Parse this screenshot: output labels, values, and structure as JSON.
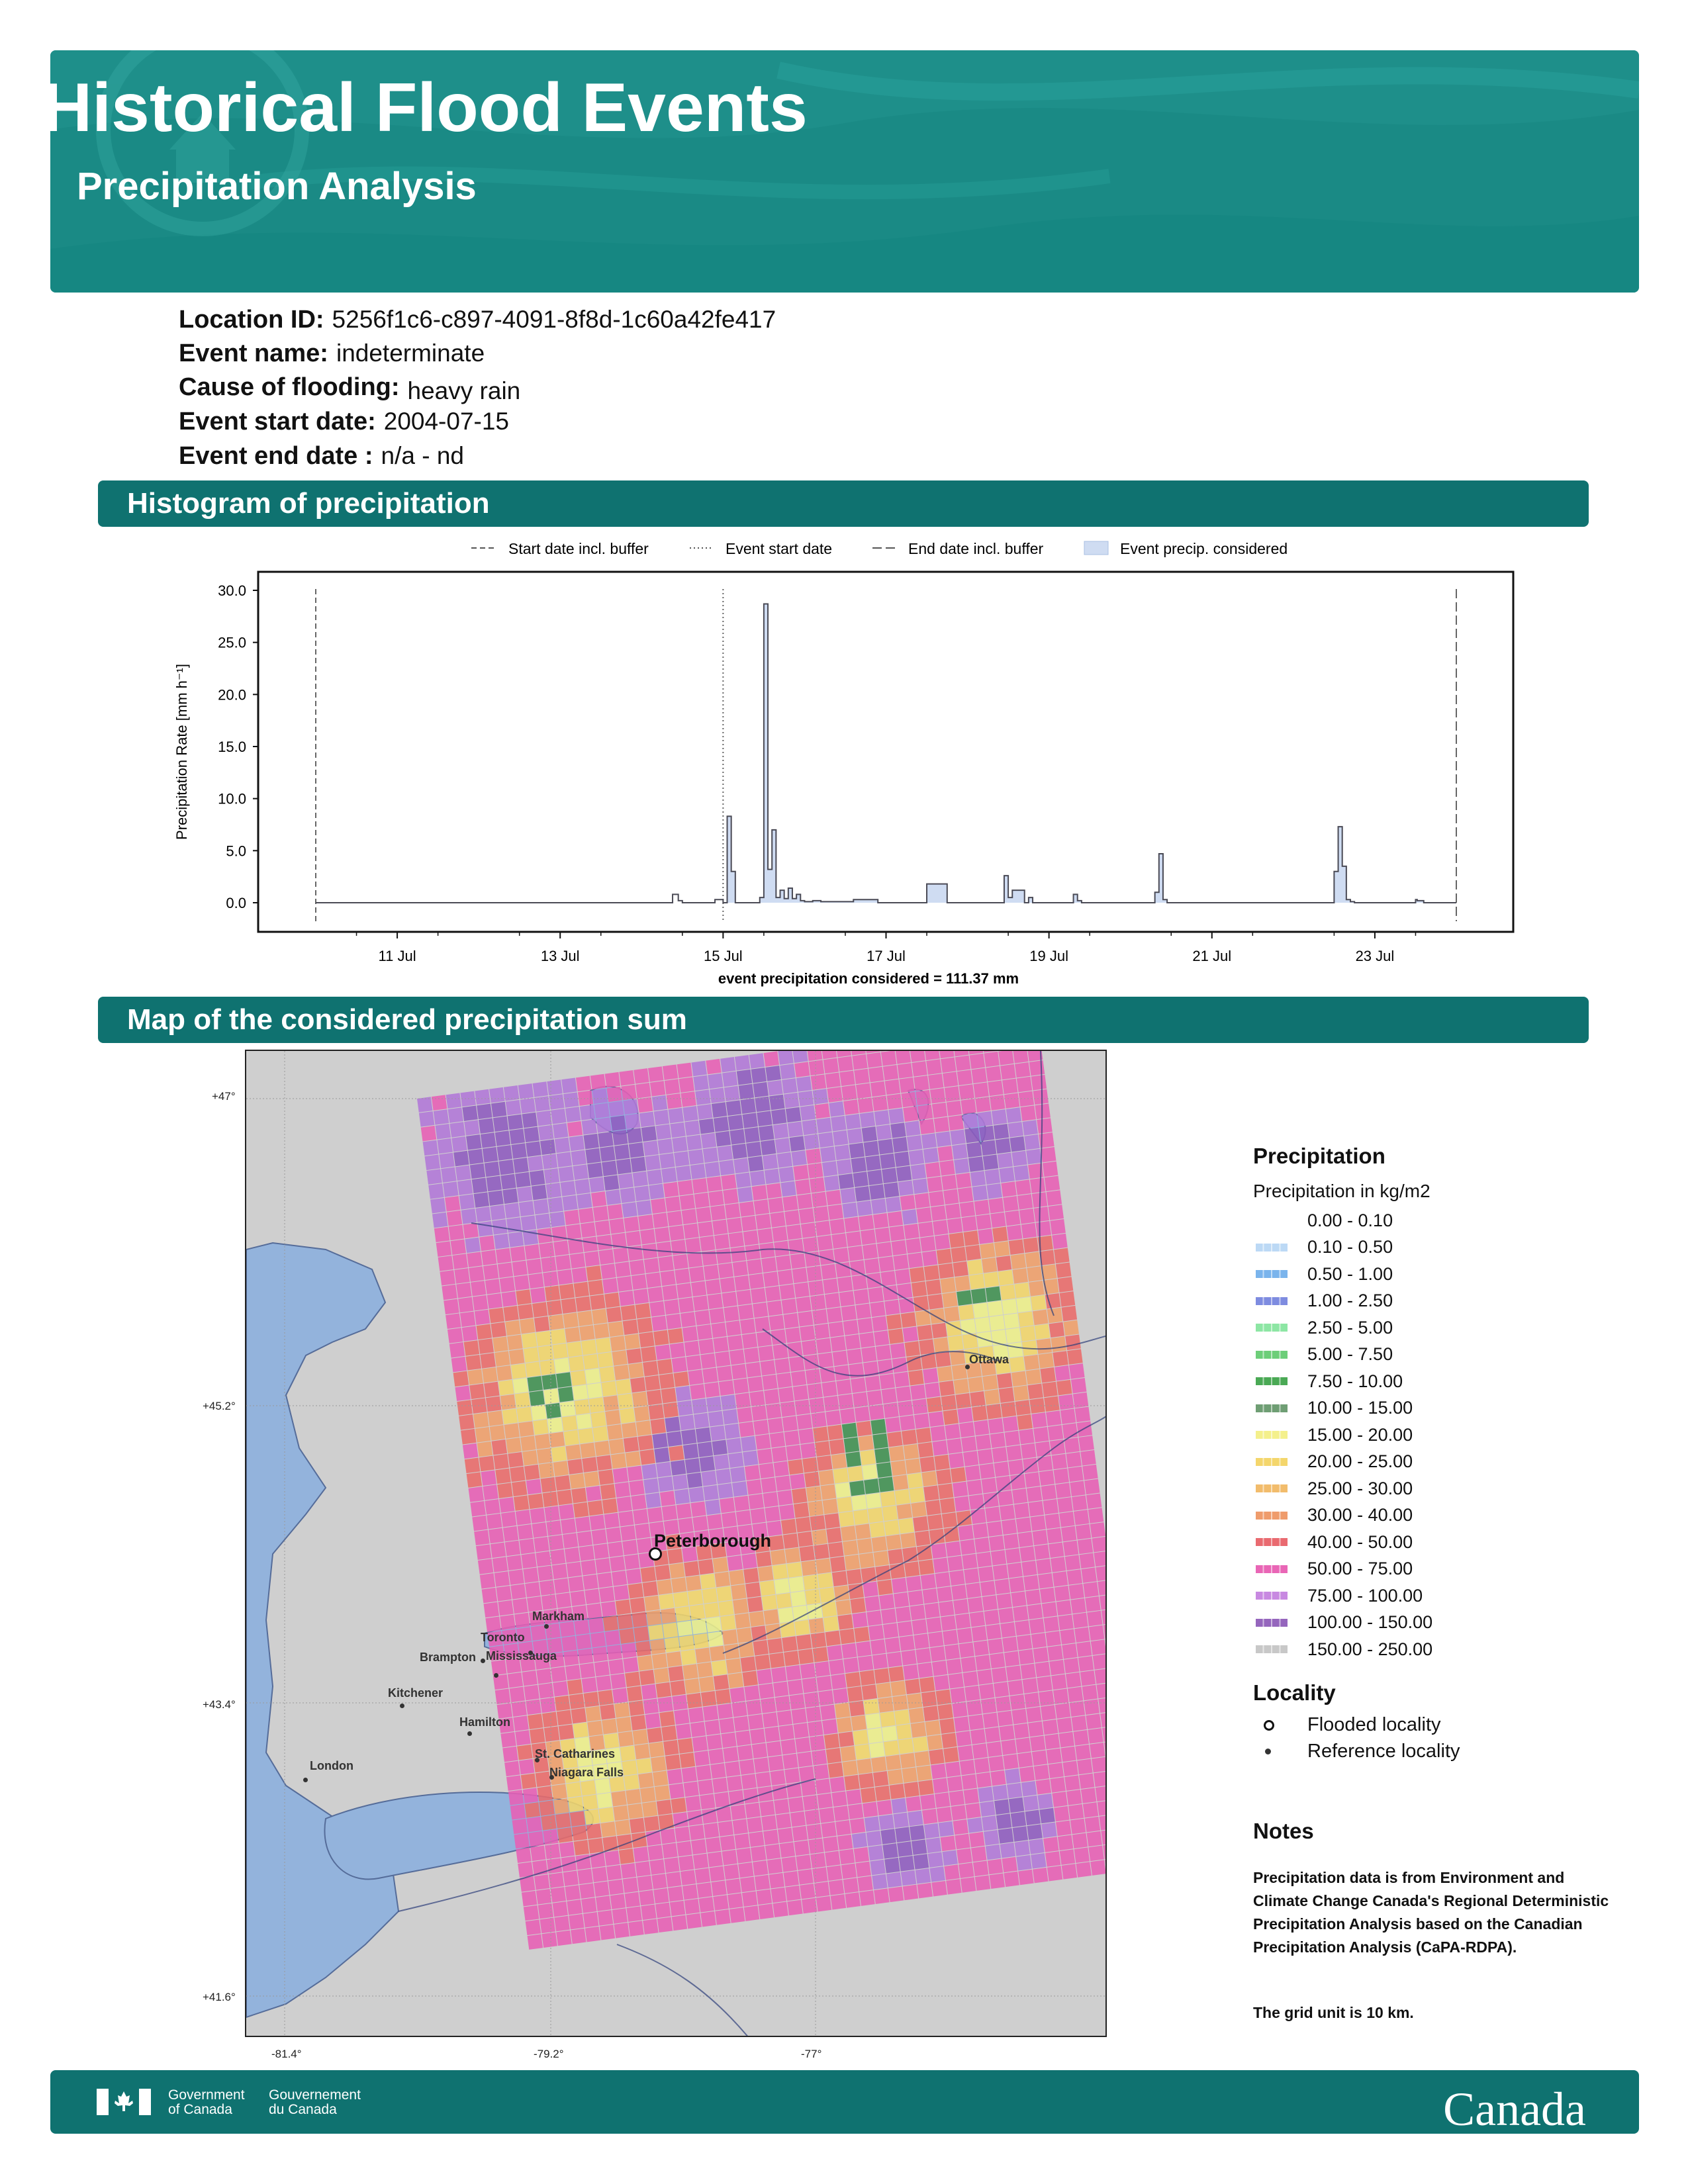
{
  "header": {
    "title": "Historical Flood Events",
    "subtitle": "Precipitation Analysis"
  },
  "event_info": {
    "location_id": {
      "label": "Location ID:",
      "value": "5256f1c6-c897-4091-8f8d-1c60a42fe417"
    },
    "event_name": {
      "label": "Event name:",
      "value": "indeterminate"
    },
    "cause": {
      "label": "Cause of flooding:",
      "value": "heavy rain"
    },
    "start_date": {
      "label": "Event start date:",
      "value": "2004-07-15"
    },
    "end_date": {
      "label": "Event end date :",
      "value": "n/a - nd"
    }
  },
  "sections": {
    "histogram": "Histogram of precipitation",
    "map": "Map of the considered precipitation sum"
  },
  "chart_data": {
    "type": "area",
    "xlabel": "",
    "ylabel": "Precipitation Rate [mm h⁻¹]",
    "ylim": [
      0,
      30
    ],
    "yticks": [
      "0.0",
      "5.0",
      "10.0",
      "15.0",
      "20.0",
      "25.0",
      "30.0"
    ],
    "xticks": [
      "11 Jul",
      "13 Jul",
      "15 Jul",
      "17 Jul",
      "19 Jul",
      "21 Jul",
      "23 Jul"
    ],
    "legend": {
      "placement": "top",
      "entries": [
        "Start date incl. buffer",
        "Event start date",
        "End date incl. buffer",
        "Event precip. considered"
      ]
    },
    "annotation": "event precipitation considered = 111.37 mm",
    "markers": {
      "start_buffer": "2004-07-10 00:00",
      "event_start": "2004-07-15 00:00",
      "end_buffer": "2004-07-24 00:00"
    },
    "series": [
      {
        "x_days_from_10jul": [
          0,
          4.3,
          4.38,
          4.45,
          4.5,
          4.9,
          5.0,
          5.05,
          5.1,
          5.15,
          5.45,
          5.5,
          5.55,
          5.6,
          5.65,
          5.7,
          5.75,
          5.8,
          5.85,
          5.9,
          5.95,
          6.0,
          6.1,
          6.2,
          6.6,
          6.9,
          7.5,
          7.75,
          8.25,
          8.45,
          8.5,
          8.55,
          8.7,
          8.75,
          8.8,
          9.3,
          9.35,
          9.4,
          10.3,
          10.35,
          10.4,
          10.45,
          12.5,
          12.55,
          12.6,
          12.65,
          12.7,
          12.75,
          13.5,
          13.52,
          13.6,
          14.0
        ],
        "values": [
          0,
          0,
          0.8,
          0.2,
          0,
          0.3,
          0,
          8.3,
          3.0,
          0,
          0.5,
          28.7,
          3.2,
          7.0,
          0.5,
          1.2,
          0.4,
          1.4,
          0.4,
          0.8,
          0.2,
          0.1,
          0.2,
          0.1,
          0.3,
          0,
          1.8,
          0,
          0,
          2.6,
          0.5,
          1.2,
          0,
          0.5,
          0,
          0.8,
          0.2,
          0,
          1.0,
          4.7,
          0.3,
          0,
          3.0,
          7.3,
          3.5,
          0.3,
          0.1,
          0,
          0.3,
          0.2,
          0,
          0
        ]
      }
    ]
  },
  "map": {
    "lat_ticks": [
      "+47°",
      "+45.2°",
      "+43.4°",
      "+41.6°"
    ],
    "lon_ticks": [
      "-81.4°",
      "-79.2°",
      "-77°"
    ],
    "localities": [
      {
        "name": "Peterborough",
        "type": "flooded"
      },
      {
        "name": "Ottawa",
        "type": "reference"
      },
      {
        "name": "Markham",
        "type": "reference"
      },
      {
        "name": "Toronto",
        "type": "reference"
      },
      {
        "name": "Brampton",
        "type": "reference"
      },
      {
        "name": "Mississauga",
        "type": "reference"
      },
      {
        "name": "Kitchener",
        "type": "reference"
      },
      {
        "name": "Hamilton",
        "type": "reference"
      },
      {
        "name": "St. Catharines",
        "type": "reference"
      },
      {
        "name": "Niagara Falls",
        "type": "reference"
      },
      {
        "name": "London",
        "type": "reference"
      }
    ],
    "grid_colors": {
      "background": "#cfcfcf",
      "water": "#93b3dc",
      "magenta": "#e85fb5",
      "purple": "#b278d8",
      "dark_purple": "#8e5bbf",
      "red": "#ea6b6a",
      "orange": "#f09f6a",
      "yellow": "#f3d66a",
      "pale_yellow": "#eef08a",
      "green": "#3f8f50"
    }
  },
  "legend": {
    "title": "Precipitation",
    "subtitle": "Precipitation in kg/m2",
    "items": [
      {
        "label": "0.00 - 0.10",
        "color": "#ffffff"
      },
      {
        "label": "0.10 - 0.50",
        "color": "#bcd9f5"
      },
      {
        "label": "0.50 - 1.00",
        "color": "#7ab4ec"
      },
      {
        "label": "1.00 - 2.50",
        "color": "#7e8ce0"
      },
      {
        "label": "2.50 - 5.00",
        "color": "#8de6a4"
      },
      {
        "label": "5.00 - 7.50",
        "color": "#6dce79"
      },
      {
        "label": "7.50 - 10.00",
        "color": "#4aa955"
      },
      {
        "label": "10.00 - 15.00",
        "color": "#6f9e74"
      },
      {
        "label": "15.00 - 20.00",
        "color": "#f4f08c"
      },
      {
        "label": "20.00 - 25.00",
        "color": "#f4d66c"
      },
      {
        "label": "25.00 - 30.00",
        "color": "#f2bc6c"
      },
      {
        "label": "30.00 - 40.00",
        "color": "#ef9c6c"
      },
      {
        "label": "40.00 - 50.00",
        "color": "#e96a70"
      },
      {
        "label": "50.00 - 75.00",
        "color": "#e966b6"
      },
      {
        "label": "75.00 - 100.00",
        "color": "#c889e1"
      },
      {
        "label": "100.00 - 150.00",
        "color": "#9566bd"
      },
      {
        "label": "150.00 - 250.00",
        "color": "#c8c8c8"
      }
    ],
    "locality_title": "Locality",
    "locality_items": [
      "Flooded locality",
      "Reference locality"
    ]
  },
  "notes": {
    "title": "Notes",
    "text1": "Precipitation data is from Environment and Climate Change Canada's Regional Deterministic Precipitation Analysis based on the Canadian Precipitation Analysis (CaPA-RDPA).",
    "text2": "The grid unit is 10 km."
  },
  "footer": {
    "gov_en_1": "Government",
    "gov_en_2": "of Canada",
    "gov_fr_1": "Gouvernement",
    "gov_fr_2": "du Canada",
    "wordmark": "Canada"
  }
}
